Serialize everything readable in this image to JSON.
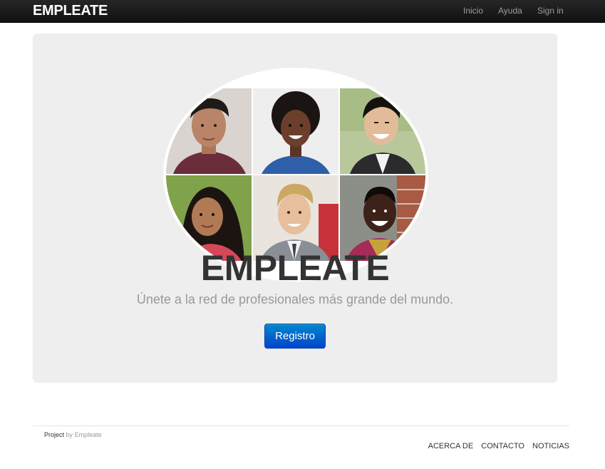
{
  "navbar": {
    "brand": "EMPLEATE",
    "links": [
      {
        "label": "Inicio"
      },
      {
        "label": "Ayuda"
      },
      {
        "label": "Sign in"
      }
    ]
  },
  "hero": {
    "title": "EMPLEATE",
    "subtitle": "Únete a la red de profesionales más grande del mundo.",
    "button_label": "Registro"
  },
  "footer": {
    "credit_project": "Project",
    "credit_by": "by",
    "credit_name": "Empleate",
    "links": [
      {
        "label": "ACERCA DE"
      },
      {
        "label": "CONTACTO"
      },
      {
        "label": "NOTICIAS"
      }
    ]
  },
  "colors": {
    "navbar_bg": "#1b1b1b",
    "hero_bg": "#eeeeee",
    "button_primary": "#0066cc",
    "title_text": "#333333",
    "subtitle_text": "#999999"
  }
}
